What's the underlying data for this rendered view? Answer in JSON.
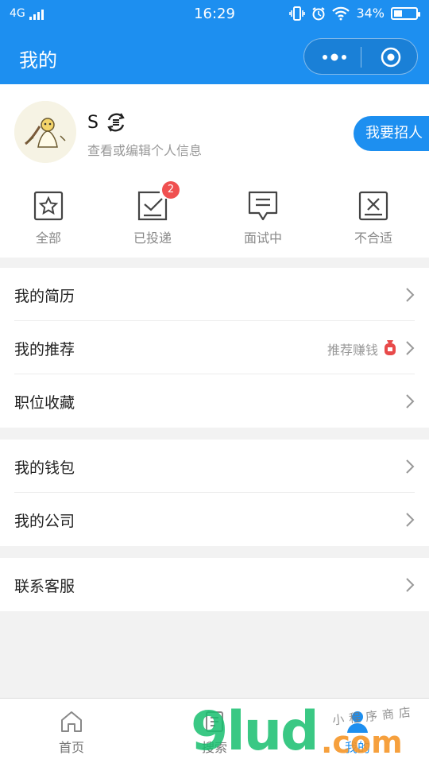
{
  "status_bar": {
    "network": "4G",
    "time": "16:29",
    "battery": "34%"
  },
  "header": {
    "title": "我的",
    "icons": [
      "more-icon",
      "target-icon"
    ]
  },
  "profile": {
    "name": "S",
    "subtitle": "查看或编辑个人信息",
    "recruit_button": "我要招人"
  },
  "statuses": [
    {
      "label": "全部",
      "icon": "star-box-icon"
    },
    {
      "label": "已投递",
      "icon": "check-box-icon",
      "badge": "2"
    },
    {
      "label": "面试中",
      "icon": "chat-icon"
    },
    {
      "label": "不合适",
      "icon": "x-box-icon"
    }
  ],
  "menu_groups": [
    [
      {
        "label": "我的简历"
      },
      {
        "label": "我的推荐",
        "extra": "推荐赚钱"
      },
      {
        "label": "职位收藏"
      }
    ],
    [
      {
        "label": "我的钱包"
      },
      {
        "label": "我的公司"
      }
    ],
    [
      {
        "label": "联系客服"
      }
    ]
  ],
  "tabbar": [
    {
      "label": "首页",
      "icon": "home-icon",
      "active": false
    },
    {
      "label": "搜索",
      "icon": "search-icon",
      "active": false
    },
    {
      "label": "我的",
      "icon": "user-icon",
      "active": true
    }
  ],
  "watermark": {
    "brand": "9lud",
    "domain": ".com",
    "tagline": "小程序商店"
  },
  "colors": {
    "primary": "#1d8ff0",
    "badge": "#f05050",
    "background": "#f2f2f2"
  }
}
